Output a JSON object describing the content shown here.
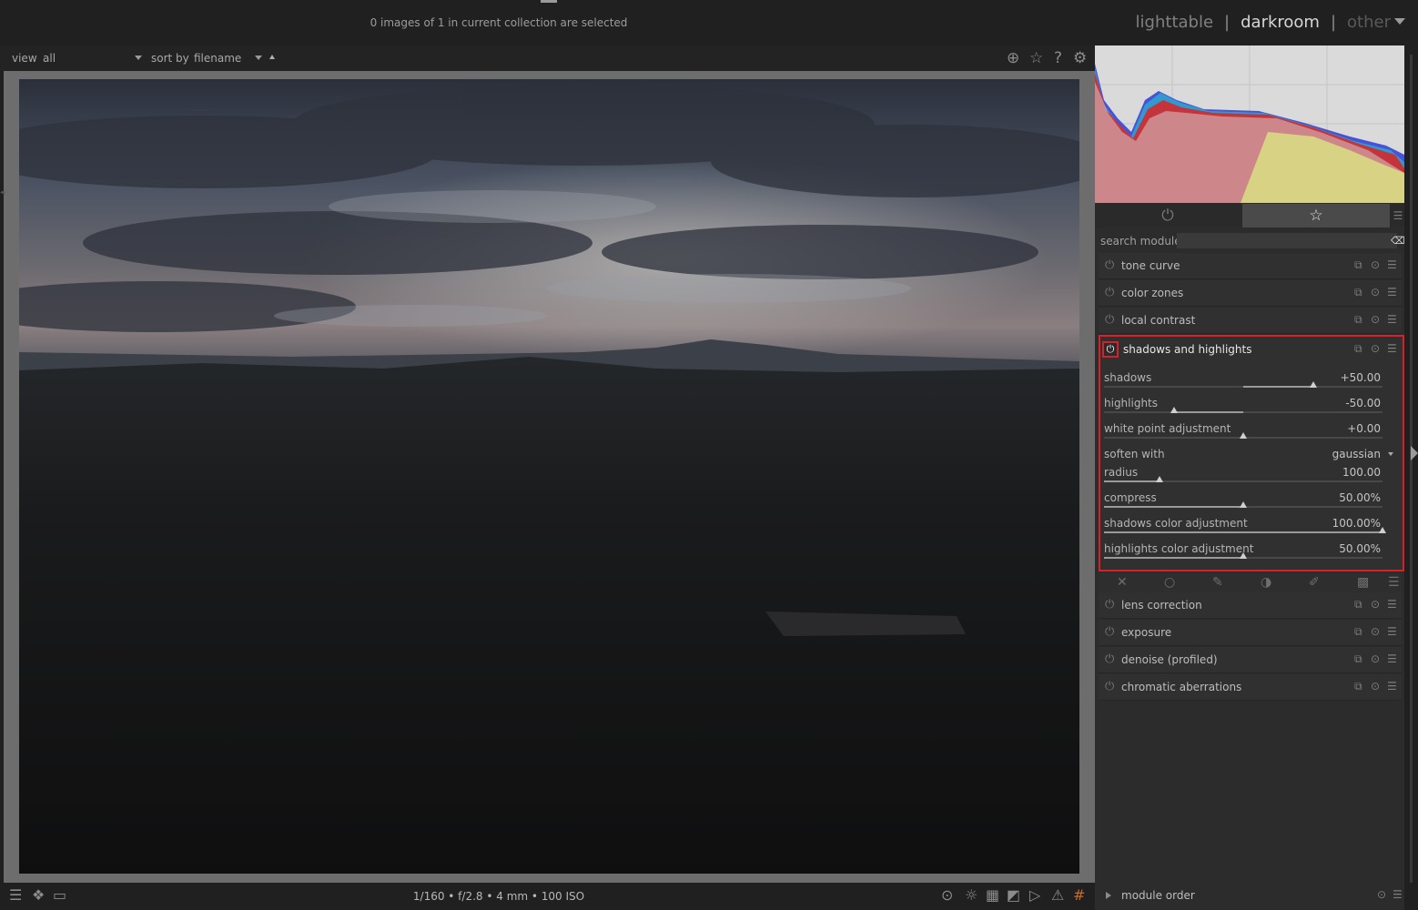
{
  "top": {
    "collection_info": "0 images of 1 in current collection are selected",
    "views": {
      "lighttable": "lighttable",
      "separator": "|",
      "darkroom": "darkroom",
      "other": "other"
    }
  },
  "filterbar": {
    "view_label": "view",
    "view_value": "all",
    "sort_label": "sort by",
    "sort_value": "filename",
    "icons": [
      "overlay-icon",
      "star-icon",
      "help-icon",
      "gear-icon"
    ]
  },
  "exif_info": "1/160 • f/2.8 • 4 mm • 100 ISO",
  "panel": {
    "search_label": "search module",
    "search_value": "",
    "modules_top": [
      {
        "name": "tone curve"
      },
      {
        "name": "color zones"
      },
      {
        "name": "local contrast"
      }
    ],
    "expanded_module": {
      "name": "shadows and highlights",
      "params": [
        {
          "label": "shadows",
          "value": "+50.00",
          "level": 0.75,
          "fill_from": 0.5
        },
        {
          "label": "highlights",
          "value": "-50.00",
          "level": 0.25,
          "fill_from": 0.5
        },
        {
          "label": "white point adjustment",
          "value": "+0.00",
          "level": 0.5,
          "fill_from": 0.5
        },
        {
          "label": "soften with",
          "value": "gaussian"
        },
        {
          "label": "radius",
          "value": "100.00",
          "level": 0.2,
          "fill_from": 0
        },
        {
          "label": "compress",
          "value": "50.00%",
          "level": 0.5,
          "fill_from": 0
        },
        {
          "label": "shadows color adjustment",
          "value": "100.00%",
          "level": 1.0,
          "fill_from": 0
        },
        {
          "label": "highlights color adjustment",
          "value": "50.00%",
          "level": 0.5,
          "fill_from": 0
        }
      ]
    },
    "modules_bottom": [
      {
        "name": "lens correction"
      },
      {
        "name": "exposure"
      },
      {
        "name": "denoise (profiled)"
      },
      {
        "name": "chromatic aberrations"
      }
    ],
    "module_order_label": "module order"
  },
  "colors": {
    "accent_highlight": "#d8202a",
    "panel_bg": "#2c2c2c",
    "histogram_red": "#d42a2a",
    "histogram_yellow": "#d8cc30",
    "histogram_blue": "#2a3ad8"
  }
}
